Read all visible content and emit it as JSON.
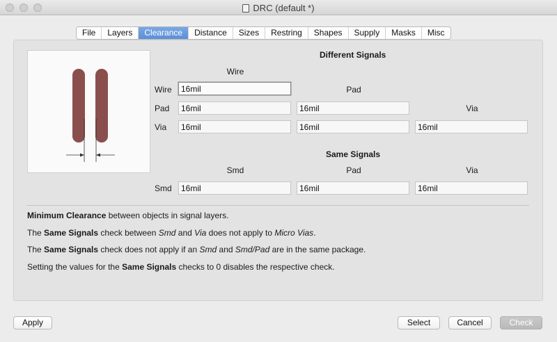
{
  "window": {
    "title": "DRC (default *)"
  },
  "tabs": [
    {
      "label": "File"
    },
    {
      "label": "Layers"
    },
    {
      "label": "Clearance",
      "active": true
    },
    {
      "label": "Distance"
    },
    {
      "label": "Sizes"
    },
    {
      "label": "Restring"
    },
    {
      "label": "Shapes"
    },
    {
      "label": "Supply"
    },
    {
      "label": "Masks"
    },
    {
      "label": "Misc"
    }
  ],
  "different": {
    "heading": "Different Signals",
    "col_wire": "Wire",
    "col_pad": "Pad",
    "col_via": "Via",
    "row_wire": "Wire",
    "row_pad": "Pad",
    "row_via": "Via",
    "wire_wire": "16mil",
    "pad_wire": "16mil",
    "pad_pad": "16mil",
    "via_wire": "16mil",
    "via_pad": "16mil",
    "via_via": "16mil"
  },
  "same": {
    "heading": "Same Signals",
    "col_smd": "Smd",
    "col_pad": "Pad",
    "col_via": "Via",
    "row_smd": "Smd",
    "smd_smd": "16mil",
    "smd_pad": "16mil",
    "smd_via": "16mil"
  },
  "notes": {
    "n1_b": "Minimum Clearance",
    "n1_t": " between objects in signal layers.",
    "n2_a": "The ",
    "n2_b": "Same Signals",
    "n2_c": " check between ",
    "n2_d": "Smd",
    "n2_e": " and ",
    "n2_f": "Via",
    "n2_g": " does not apply to ",
    "n2_h": "Micro Vias",
    "n2_i": ".",
    "n3_a": "The ",
    "n3_b": "Same Signals",
    "n3_c": " check does not apply if an ",
    "n3_d": "Smd",
    "n3_e": " and ",
    "n3_f": "Smd/Pad",
    "n3_g": " are in the same package.",
    "n4_a": "Setting the values for the ",
    "n4_b": "Same Signals",
    "n4_c": " checks to 0 disables the respective check."
  },
  "buttons": {
    "apply": "Apply",
    "select": "Select",
    "cancel": "Cancel",
    "check": "Check"
  },
  "colors": {
    "trace": "#8a4f4d",
    "tab_active": "#5b8fd8"
  }
}
